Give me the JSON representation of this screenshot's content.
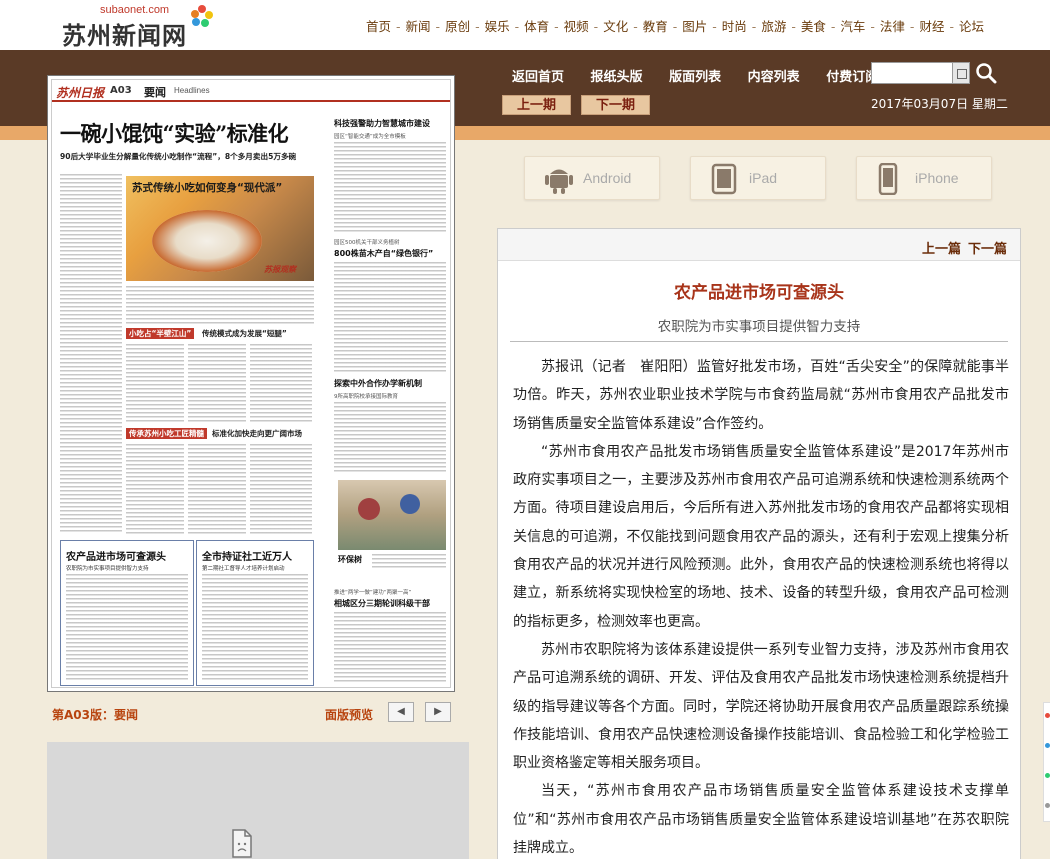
{
  "site": {
    "logo_sub": "subaonet.com",
    "logo_main": "苏州新闻网",
    "nav": [
      "首页",
      "新闻",
      "原创",
      "娱乐",
      "体育",
      "视频",
      "文化",
      "教育",
      "图片",
      "时尚",
      "旅游",
      "美食",
      "汽车",
      "法律",
      "财经",
      "论坛"
    ],
    "nav_separator": "-"
  },
  "epaper_nav": {
    "items": [
      "返回首页",
      "报纸头版",
      "版面列表",
      "内容列表",
      "付费订阅"
    ],
    "prev_issue": "上一期",
    "next_issue": "下一期",
    "date": "2017年03月07日 星期二",
    "search_value": ""
  },
  "newspaper": {
    "paper_name": "苏州日报",
    "page_no": "A03",
    "section": "要闻",
    "headlines_label": "Headlines",
    "main_title": "一碗小馄饨“实验”标准化",
    "subtitle": "90后大学毕业生分解量化传统小吃制作“流程”，8个多月卖出5万多碗",
    "photo_title": "苏式传统小吃如何变身“现代派”",
    "photo_badge": "苏报观察",
    "banner1": "小吃占“半壁江山”",
    "banner1_tail": "传统模式成为发展“短腿”",
    "banner2": "传承苏州小吃工匠精髓",
    "banner2_tail": "标准化加快走向更广阔市场",
    "right_head1": "科技强警助力智慧城市建设",
    "right_sub1": "园区“智能交通”成为全市模板",
    "right_small2": "园区500机关干部义务植树",
    "right_head2": "800株苗木产自“绿色银行”",
    "right_head3": "探索中外合作办学新机制",
    "right_sub3": "9所高职院校承接国际教育",
    "photo2_caption": "环保树",
    "right_small4": "推进“两学一做”建功“两聚一高”",
    "right_head4": "相城区分三期轮训科级干部",
    "box1_title": "农产品进市场可查源头",
    "box1_sub": "农职院为市实事项目提供智力支持",
    "box2_title": "全市持证社工近万人",
    "box2_sub": "第二期社工督导人才培养计划启动"
  },
  "page_footer": {
    "page_label": "第A03版：要闻",
    "preview_label": "面版预览",
    "prev_arrow": "◀",
    "next_arrow": "▶"
  },
  "apps": [
    {
      "label": "Android",
      "icon": "android-icon"
    },
    {
      "label": "iPad",
      "icon": "tablet-icon"
    },
    {
      "label": "iPhone",
      "icon": "phone-icon"
    }
  ],
  "article": {
    "prev": "上一篇",
    "next": "下一篇",
    "title": "农产品进市场可查源头",
    "subtitle": "农职院为市实事项目提供智力支持",
    "paragraphs": [
      "苏报讯（记者　崔阳阳）监管好批发市场，百姓“舌尖安全”的保障就能事半功倍。昨天，苏州农业职业技术学院与市食药监局就“苏州市食用农产品批发市场销售质量安全监管体系建设”合作签约。",
      "“苏州市食用农产品批发市场销售质量安全监管体系建设”是2017年苏州市政府实事项目之一，主要涉及苏州市食用农产品可追溯系统和快速检测系统两个方面。待项目建设启用后，今后所有进入苏州批发市场的食用农产品都将实现相关信息的可追溯，不仅能找到问题食用农产品的源头，还有利于宏观上搜集分析食用农产品的状况并进行风险预测。此外，食用农产品的快速检测系统也将得以建立，新系统将实现快检室的场地、技术、设备的转型升级，食用农产品可检测的指标更多，检测效率也更高。",
      "苏州市农职院将为该体系建设提供一系列专业智力支持，涉及苏州市食用农产品可追溯系统的调研、开发、评估及食用农产品批发市场快速检测系统提档升级的指导建议等各个方面。同时，学院还将协助开展食用农产品质量跟踪系统操作技能培训、食用农产品快速检测设备操作技能培训、食品检验工和化学检验工职业资格鉴定等相关服务项目。",
      "当天，“苏州市食用农产品市场销售质量安全监管体系建设技术支撑单位”和“苏州市食用农产品市场销售质量安全监管体系建设培训基地”在苏农职院挂牌成立。"
    ]
  },
  "colors": {
    "brown_header": "#5a3a26",
    "orange_strip": "#e8a868",
    "page_bg": "#f2ebdb",
    "accent_red": "#a8341a",
    "nav_text": "#6b3d0e"
  }
}
